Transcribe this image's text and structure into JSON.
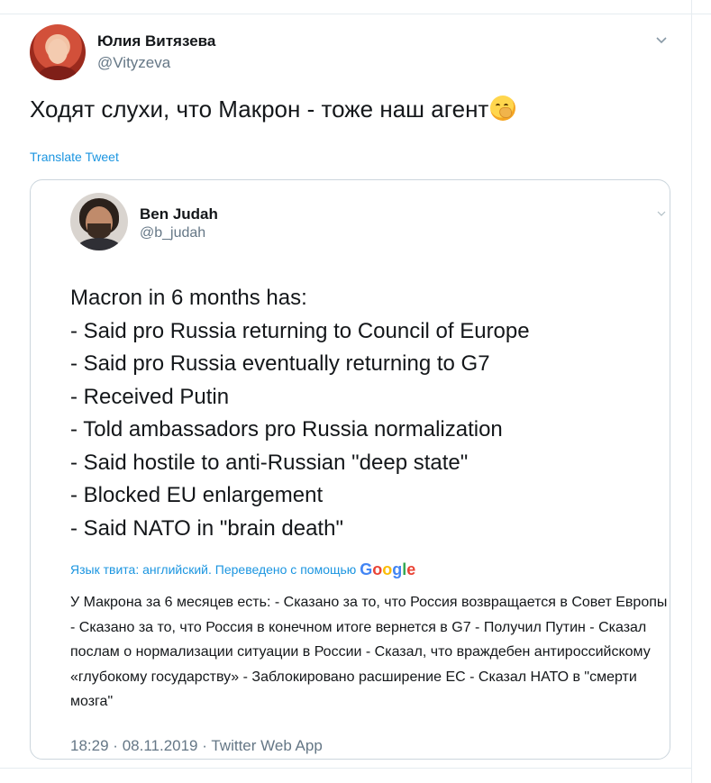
{
  "author": {
    "name": "Юлия Витязева",
    "handle": "@Vityzeva"
  },
  "tweet": {
    "text": "Ходят слухи, что Макрон - тоже наш агент",
    "emoji_icon": "face-with-hand-over-mouth-emoji",
    "translate_label": "Translate Tweet"
  },
  "quoted": {
    "author": {
      "name": "Ben Judah",
      "handle": "@b_judah"
    },
    "lines": [
      "Macron in 6 months has:",
      "- Said pro Russia returning to Council of Europe",
      "- Said pro Russia eventually returning to G7",
      "- Received Putin",
      "- Told ambassadors pro Russia normalization",
      "- Said hostile to anti-Russian \"deep state\"",
      "- Blocked EU enlargement",
      "- Said NATO in \"brain death\""
    ],
    "translation_label": "Язык твита: английский. Переведено с помощью",
    "translation_provider": "Google",
    "translation_text": "У Макрона за 6 месяцев есть: - Сказано за то, что Россия возвращается в Совет Европы - Сказано за то, что Россия в конечном итоге вернется в G7 - Получил Путин - Сказал послам о нормализации ситуации в России - Сказал, что враждебен антироссийскому «глубокому государству» - Заблокировано расширение ЕС - Сказал НАТО в \"смерти мозга\"",
    "time": "18:29",
    "date": "08.11.2019",
    "separator": "·",
    "source": "Twitter Web App"
  },
  "colors": {
    "link": "#1b95e0",
    "secondary": "#657786",
    "border": "#ccd6dd",
    "text": "#14171a"
  },
  "icons": {
    "menu": "chevron-down-icon"
  }
}
